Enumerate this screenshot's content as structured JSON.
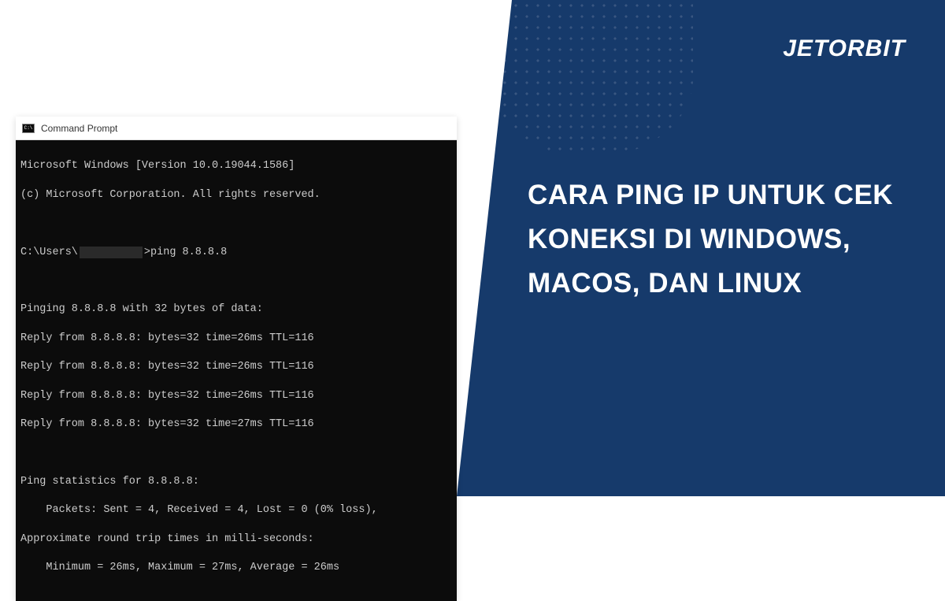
{
  "brand": {
    "logo_text": "JETORBIT"
  },
  "headline": "CARA PING IP UNTUK CEK KONEKSI DI WINDOWS, MACOS, DAN LINUX",
  "terminal": {
    "title": "Command Prompt",
    "lines": {
      "version": "Microsoft Windows [Version 10.0.19044.1586]",
      "copyright": "(c) Microsoft Corporation. All rights reserved.",
      "prompt_prefix": "C:\\Users\\",
      "prompt_cmd": ">ping 8.8.8.8",
      "pinging": "Pinging 8.8.8.8 with 32 bytes of data:",
      "reply1": "Reply from 8.8.8.8: bytes=32 time=26ms TTL=116",
      "reply2": "Reply from 8.8.8.8: bytes=32 time=26ms TTL=116",
      "reply3": "Reply from 8.8.8.8: bytes=32 time=26ms TTL=116",
      "reply4": "Reply from 8.8.8.8: bytes=32 time=27ms TTL=116",
      "stats_header": "Ping statistics for 8.8.8.8:",
      "stats_packets": "    Packets: Sent = 4, Received = 4, Lost = 0 (0% loss),",
      "rtt_header": "Approximate round trip times in milli-seconds:",
      "rtt_values": "    Minimum = 26ms, Maximum = 27ms, Average = 26ms"
    }
  }
}
